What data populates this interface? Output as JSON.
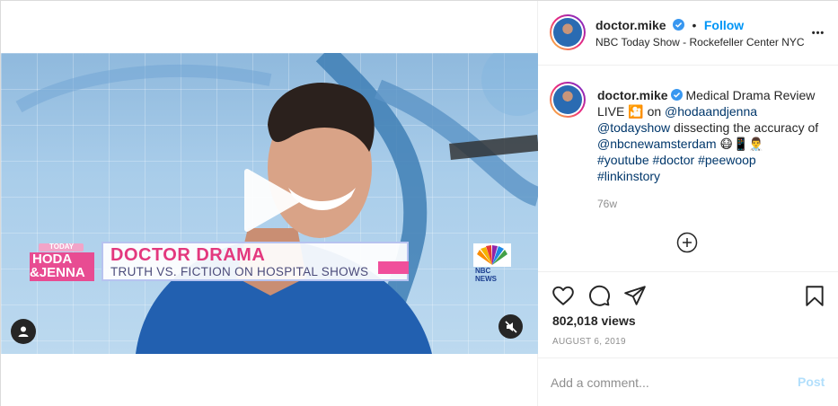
{
  "post": {
    "username": "doctor.mike",
    "follow_label": "Follow",
    "separator": "•",
    "location": "NBC Today Show - Rockefeller Center NYC",
    "more_label": "•••"
  },
  "caption": {
    "username": "doctor.mike",
    "text_1": " Medical Drama Review LIVE ",
    "live_emoji": "🎦",
    "text_2": " on ",
    "mention_1": "@hodaandjenna",
    "mention_2": "@todayshow",
    "text_3": " dissecting the accuracy of ",
    "mention_3": "@nbcnewamsterdam",
    "emojis": " 😷📱👨‍⚕️",
    "tag_1": "#youtube",
    "tag_2": "#doctor",
    "tag_3": "#peewoop",
    "tag_4": "#linkinstory",
    "age": "76w"
  },
  "stats": {
    "views": "802,018 views",
    "date": "AUGUST 6, 2019"
  },
  "comment": {
    "placeholder": "Add a comment...",
    "post_label": "Post"
  },
  "video_overlay": {
    "brand_top": "TODAY",
    "brand_hoda": "HODA",
    "brand_jenna": "&JENNA",
    "headline": "DOCTOR DRAMA",
    "subheadline": "TRUTH VS. FICTION ON HOSPITAL SHOWS",
    "network": "NBC NEWS"
  },
  "colors": {
    "accent": "#0095f6",
    "verified": "#3897f0",
    "link": "#00376b",
    "muted": "#8e8e8e",
    "headline_pink": "#e3387e"
  },
  "icons": {
    "like": "heart-icon",
    "comment": "comment-icon",
    "share": "send-icon",
    "save": "bookmark-icon",
    "play": "play-icon",
    "mute": "mute-icon",
    "tagged": "user-tag-icon",
    "load_more": "plus-circle-icon"
  }
}
